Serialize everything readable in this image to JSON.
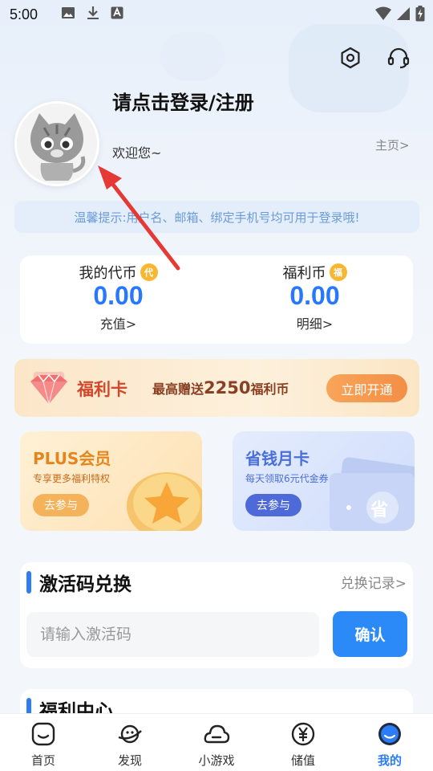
{
  "status_bar": {
    "time": "5:00"
  },
  "header": {
    "settings_icon": "gear-icon",
    "service_icon": "headset-icon"
  },
  "profile": {
    "login_prompt": "请点击登录/注册",
    "welcome": "欢迎您~",
    "home_link": "主页>"
  },
  "tip": {
    "text": "温馨提示:用户名、邮箱、绑定手机号均可用于登录哦!"
  },
  "coins": {
    "my_coin": {
      "label": "我的代币",
      "badge": "代",
      "value": "0.00",
      "action": "充值>"
    },
    "welfare_coin": {
      "label": "福利币",
      "badge": "福",
      "value": "0.00",
      "action": "明细>"
    }
  },
  "welfare_card": {
    "name": "福利卡",
    "desc_prefix": "最高赠送",
    "desc_amount": "2250",
    "desc_suffix": "福利币",
    "button": "立即开通"
  },
  "promos": {
    "plus": {
      "title": "PLUS会员",
      "subtitle": "专享更多福利特权",
      "button": "去参与"
    },
    "month": {
      "title": "省钱月卡",
      "subtitle": "每天领取6元代金券",
      "button": "去参与",
      "card_glyph": "省"
    }
  },
  "redeem": {
    "title": "激活码兑换",
    "record_link": "兑换记录>",
    "placeholder": "请输入激活码",
    "confirm": "确认"
  },
  "welfare_center": {
    "title": "福利中心"
  },
  "tabs": [
    {
      "label": "首页",
      "icon": "home-icon",
      "active": false
    },
    {
      "label": "发现",
      "icon": "planet-icon",
      "active": false
    },
    {
      "label": "小游戏",
      "icon": "cloud-icon",
      "active": false
    },
    {
      "label": "储值",
      "icon": "yen-icon",
      "active": false
    },
    {
      "label": "我的",
      "icon": "profile-icon",
      "active": true
    }
  ],
  "colors": {
    "accent": "#2B7CF6",
    "coin_value": "#2878FF",
    "welfare_red": "#D3472B",
    "plus_orange": "#E4861D",
    "month_blue": "#4A6FD9"
  }
}
